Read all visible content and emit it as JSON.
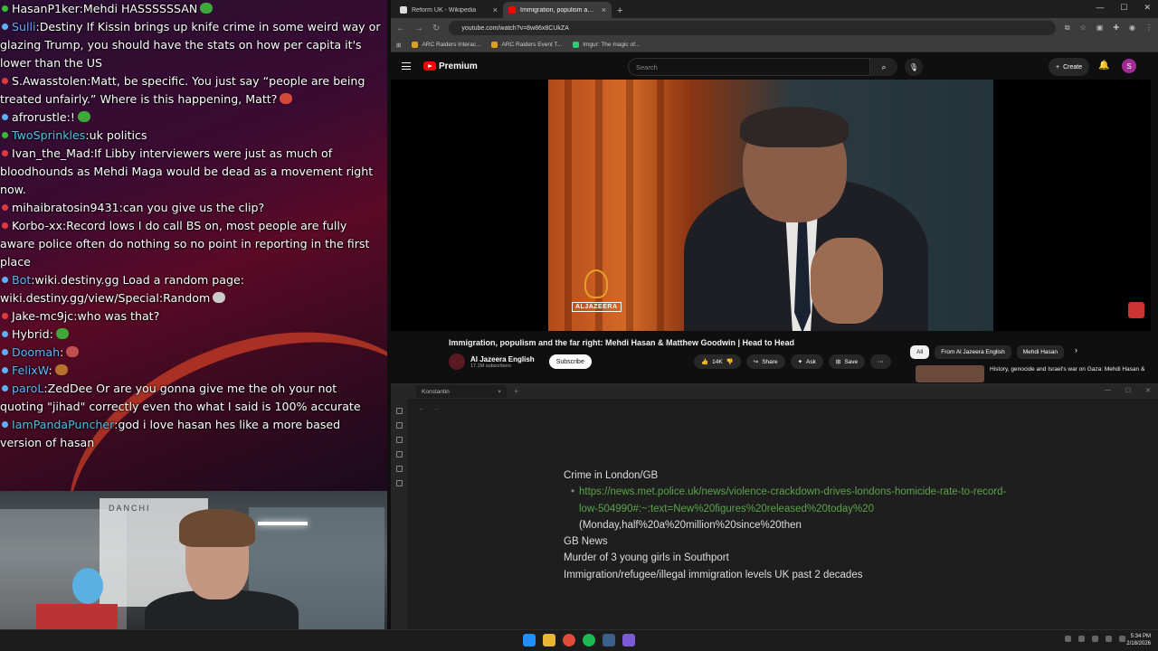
{
  "chat": {
    "messages": [
      {
        "user": "HasanP1ker",
        "text": "Mehdi HASSSSSSAN",
        "color": "#ffffff",
        "dot": "#2fbf2f",
        "emote": "#3ea83a"
      },
      {
        "user": "Sulli",
        "text": "Destiny If Kissin brings up knife crime in some weird way or glazing Trump, you should have the stats on how per capita it's lower than the US",
        "color": "#6aa7ff",
        "dot": "#5bb0ff"
      },
      {
        "user": "S.Awasstolen",
        "text": "Matt, be specific. You just say “people are being treated unfairly.” Where is this happening, Matt?",
        "color": "#ffffff",
        "dot": "#e23a3a",
        "emote": "#d24b3a"
      },
      {
        "user": "afrorustle",
        "text": "!",
        "color": "#ffffff",
        "dot": "#5bb0ff",
        "emote": "#3ea83a"
      },
      {
        "user": "TwoSprinkles",
        "text": "uk politics",
        "color": "#53c0e6",
        "dot": "#2fbf2f"
      },
      {
        "user": "Ivan_the_Mad",
        "text": "If Libby interviewers were just as much of bloodhounds as Mehdi Maga would be dead as a movement right now.",
        "color": "#ffffff",
        "dot": "#e23a3a"
      },
      {
        "user": "mihaibratosin9431",
        "text": "can you give us the clip?",
        "color": "#ffffff",
        "dot": "#e23a3a"
      },
      {
        "user": "Korbo-xx",
        "text": "Record lows I do call BS on, most people are fully aware police often do nothing so no point in reporting in the first place",
        "color": "#ffffff",
        "dot": "#e23a3a"
      },
      {
        "user": "Bot",
        "text": "wiki.destiny.gg Load a random page: wiki.destiny.gg/view/Special:Random",
        "color": "#5fb6ff",
        "dot": "#5bb0ff",
        "emote": "#cccccc"
      },
      {
        "user": "Jake-mc9jc",
        "text": "who was that?",
        "color": "#ffffff",
        "dot": "#e23a3a"
      },
      {
        "user": "Hybrid",
        "text": "",
        "color": "#ffffff",
        "dot": "#5bb0ff",
        "emote": "#3ea83a"
      },
      {
        "user": "Doomah",
        "text": "",
        "color": "#5fb6ff",
        "dot": "#5bb0ff",
        "emote": "#c0504d"
      },
      {
        "user": "FelixW",
        "text": "",
        "color": "#5fb6ff",
        "dot": "#5bb0ff",
        "emote": "#b8722c"
      },
      {
        "user": "paroL",
        "text": "ZedDee Or are you gonna give me the oh your not quoting \"jihad\" correctly even tho what I said is 100% accurate",
        "color": "#5fb6ff",
        "dot": "#5bb0ff"
      },
      {
        "user": "IamPandaPuncher",
        "text": "god i love hasan hes like a more based version of hasan",
        "color": "#53c0e6",
        "dot": "#5bb0ff"
      }
    ]
  },
  "webcam": {
    "poster_text": "DANCHI"
  },
  "browser": {
    "tabs": [
      {
        "label": "Reform UK - Wikipedia",
        "favicon_color": "#dddddd"
      },
      {
        "label": "Immigration, populism and the far right",
        "favicon_color": "#ff0000"
      }
    ],
    "url": "youtube.com/watch?v=8w86x8CUkZA",
    "bookmarks": [
      {
        "label": "ARC Raiders Interac...",
        "color": "#e0a020"
      },
      {
        "label": "ARC Raiders Event T...",
        "color": "#e0a020"
      },
      {
        "label": "Imgur: The magic of...",
        "color": "#2ecc71"
      }
    ]
  },
  "youtube": {
    "logo_label": "Premium",
    "search_placeholder": "Search",
    "create_label": "Create",
    "avatar_letter": "S",
    "channel_logo_text": "ALJAZEERA",
    "video_title": "Immigration, populism and the far right: Mehdi Hasan & Matthew Goodwin | Head to Head",
    "channel_name": "Al Jazeera English",
    "subscribers": "17.1M subscribers",
    "subscribe_label": "Subscribe",
    "like_count": "14K",
    "share_label": "Share",
    "ask_label": "Ask",
    "save_label": "Save",
    "chips": [
      "All",
      "From Al Jazeera English",
      "Mehdi Hasan"
    ],
    "rec_title": "History, genocide and Israel's war on Gaza: Mehdi Hasan &"
  },
  "obsidian": {
    "tab_title": "Konstantin",
    "note": {
      "heading1": "Crime in London/GB",
      "link": "https://news.met.police.uk/news/violence-crackdown-drives-londons-homicide-rate-to-record-low-504990#:~:text=New%20figures%20released%20today%20",
      "after_link": "(Monday,half%20a%20million%20since%20then",
      "line2": "GB News",
      "line3": "Murder of 3 young girls in Southport",
      "line4": "Immigration/refugee/illegal immigration levels UK past 2 decades"
    }
  },
  "taskbar": {
    "time": "5:34 PM",
    "date": "2/18/2026"
  }
}
